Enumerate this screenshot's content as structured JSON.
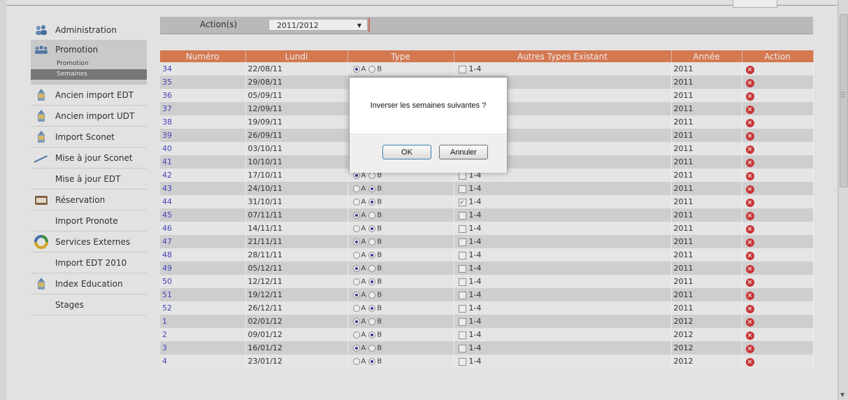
{
  "sidebar": {
    "items": [
      {
        "label": "Administration",
        "icon": "users-icon"
      },
      {
        "label": "Promotion",
        "icon": "group-icon",
        "subitems": [
          {
            "label": "Promotion",
            "active": false
          },
          {
            "label": "Semaines",
            "active": true
          }
        ]
      },
      {
        "label": "Ancien import EDT",
        "icon": "import-icon"
      },
      {
        "label": "Ancien import UDT",
        "icon": "import-icon"
      },
      {
        "label": "Import Sconet",
        "icon": "import-icon"
      },
      {
        "label": "Mise à jour Sconet",
        "icon": "pen-icon"
      },
      {
        "label": "Mise à jour EDT",
        "icon": ""
      },
      {
        "label": "Réservation",
        "icon": "reservation-icon"
      },
      {
        "label": "Import Pronote",
        "icon": ""
      },
      {
        "label": "Services Externes",
        "icon": "ring-icon"
      },
      {
        "label": "Import EDT 2010",
        "icon": ""
      },
      {
        "label": "Index Education",
        "icon": "import-icon"
      },
      {
        "label": "Stages",
        "icon": ""
      }
    ]
  },
  "header": {
    "action_label": "Action(s)",
    "year_select": "2011/2012",
    "caret": "▼"
  },
  "table": {
    "columns": [
      "Numéro",
      "Lundi",
      "Type",
      "Autres Types Existant",
      "Année",
      "Action"
    ],
    "radio_a": "A",
    "radio_b": "B",
    "check_label": "1-4",
    "rows": [
      {
        "num": "34",
        "date": "22/08/11",
        "type": "A",
        "checked": false,
        "year": "2011"
      },
      {
        "num": "35",
        "date": "29/08/11",
        "type": "B",
        "checked": false,
        "year": "2011"
      },
      {
        "num": "36",
        "date": "05/09/11",
        "type": "A",
        "checked": false,
        "year": "2011"
      },
      {
        "num": "37",
        "date": "12/09/11",
        "type": "B",
        "checked": false,
        "year": "2011"
      },
      {
        "num": "38",
        "date": "19/09/11",
        "type": "A",
        "checked": false,
        "year": "2011"
      },
      {
        "num": "39",
        "date": "26/09/11",
        "type": "B",
        "checked": false,
        "year": "2011"
      },
      {
        "num": "40",
        "date": "03/10/11",
        "type": "A",
        "checked": false,
        "year": "2011"
      },
      {
        "num": "41",
        "date": "10/10/11",
        "type": "B",
        "checked": false,
        "year": "2011"
      },
      {
        "num": "42",
        "date": "17/10/11",
        "type": "A",
        "checked": false,
        "year": "2011"
      },
      {
        "num": "43",
        "date": "24/10/11",
        "type": "B",
        "checked": false,
        "year": "2011"
      },
      {
        "num": "44",
        "date": "31/10/11",
        "type": "B",
        "checked": true,
        "year": "2011"
      },
      {
        "num": "45",
        "date": "07/11/11",
        "type": "A",
        "checked": false,
        "year": "2011"
      },
      {
        "num": "46",
        "date": "14/11/11",
        "type": "B",
        "checked": false,
        "year": "2011"
      },
      {
        "num": "47",
        "date": "21/11/11",
        "type": "A",
        "checked": false,
        "year": "2011"
      },
      {
        "num": "48",
        "date": "28/11/11",
        "type": "B",
        "checked": false,
        "year": "2011"
      },
      {
        "num": "49",
        "date": "05/12/11",
        "type": "A",
        "checked": false,
        "year": "2011"
      },
      {
        "num": "50",
        "date": "12/12/11",
        "type": "B",
        "checked": false,
        "year": "2011"
      },
      {
        "num": "51",
        "date": "19/12/11",
        "type": "A",
        "checked": false,
        "year": "2011"
      },
      {
        "num": "52",
        "date": "26/12/11",
        "type": "B",
        "checked": false,
        "year": "2011"
      },
      {
        "num": "1",
        "date": "02/01/12",
        "type": "A",
        "checked": false,
        "year": "2012"
      },
      {
        "num": "2",
        "date": "09/01/12",
        "type": "B",
        "checked": false,
        "year": "2012"
      },
      {
        "num": "3",
        "date": "16/01/12",
        "type": "A",
        "checked": false,
        "year": "2012"
      },
      {
        "num": "4",
        "date": "23/01/12",
        "type": "B",
        "checked": false,
        "year": "2012"
      }
    ]
  },
  "dialog": {
    "message": "Inverser les semaines suivantes ?",
    "ok_label": "OK",
    "cancel_label": "Annuler"
  },
  "colors": {
    "header_orange": "#e58257",
    "link_blue": "#4748c9",
    "delete_red": "#d83a3a"
  }
}
